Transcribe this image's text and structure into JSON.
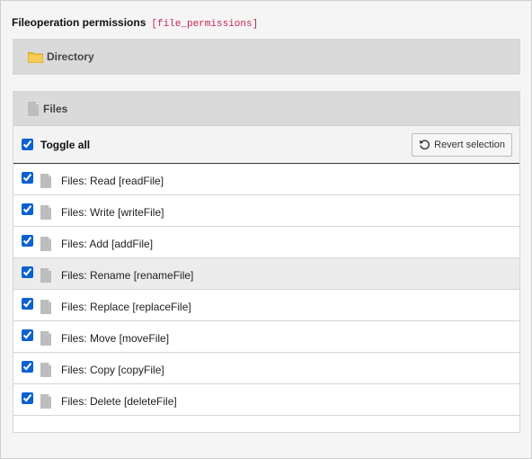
{
  "header": {
    "title": "Fileoperation permissions",
    "code": "[file_permissions]"
  },
  "directory_panel": {
    "label": "Directory",
    "icon": "folder-icon"
  },
  "files_panel": {
    "label": "Files",
    "icon": "file-icon",
    "toggle_all": {
      "label": "Toggle all",
      "checked": true
    },
    "revert_button": {
      "label": "Revert selection",
      "icon": "undo-icon"
    },
    "items": [
      {
        "label": "Files: Read [readFile]",
        "checked": true
      },
      {
        "label": "Files: Write [writeFile]",
        "checked": true
      },
      {
        "label": "Files: Add [addFile]",
        "checked": true
      },
      {
        "label": "Files: Rename [renameFile]",
        "checked": true
      },
      {
        "label": "Files: Replace [replaceFile]",
        "checked": true
      },
      {
        "label": "Files: Move [moveFile]",
        "checked": true
      },
      {
        "label": "Files: Copy [copyFile]",
        "checked": true
      },
      {
        "label": "Files: Delete [deleteFile]",
        "checked": true
      }
    ]
  },
  "colors": {
    "heading_bg": "#dadada",
    "code_text": "#c7254e",
    "checkbox_accent": "#0b61d1",
    "folder": "#f0c040"
  }
}
